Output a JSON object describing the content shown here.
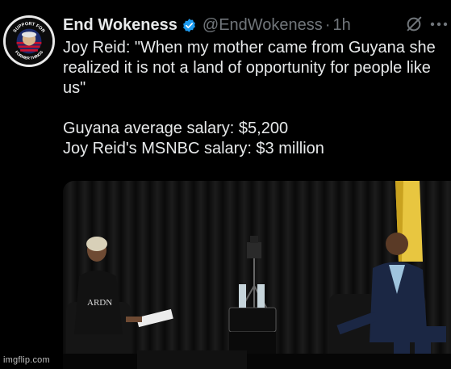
{
  "author": {
    "display_name": "End Wokeness",
    "handle": "@EndWokeness",
    "separator": "·",
    "time": "1h",
    "avatar_text_top": "SUPPORT FOR",
    "avatar_text_bottom": "FORMER THINGS"
  },
  "tweet": {
    "quote": "Joy Reid: \"When my mother came from Guyana she realized it is not a land of opportunity for people like us\"",
    "line_guyana": "Guyana average salary: $5,200",
    "line_reid": "Joy Reid's MSNBC salary: $3 million"
  },
  "media": {
    "shirt_text": "ARDN"
  },
  "icons": {
    "verified": "verified-badge-icon",
    "grok": "grok-icon",
    "more": "more-options-icon"
  },
  "colors": {
    "verified_blue": "#1d9bf0",
    "secondary_text": "#71767b",
    "primary_text": "#e7e9ea",
    "background": "#000000"
  },
  "watermark": "imgflip.com"
}
